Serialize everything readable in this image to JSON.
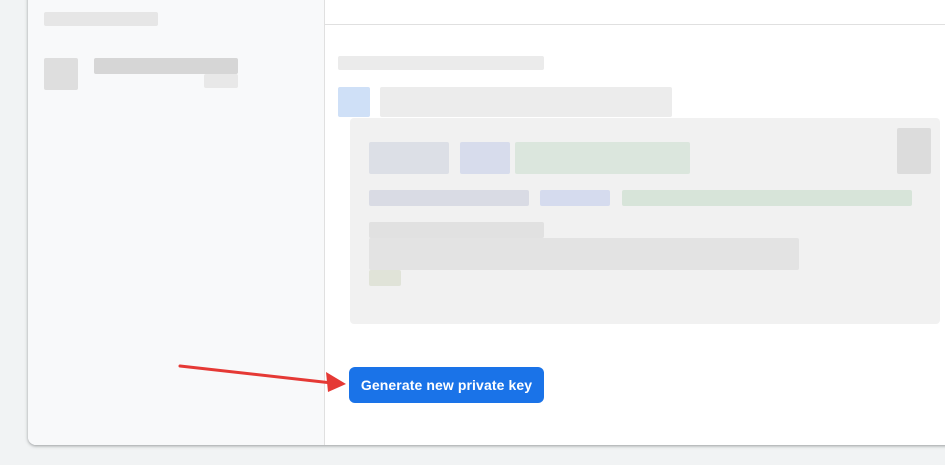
{
  "button": {
    "label": "Generate new private key"
  },
  "colors": {
    "button_bg": "#1a73e8",
    "annotation_arrow": "#e53935",
    "page_bg": "#f1f3f4",
    "sidebar_bg": "#f8f9fa"
  }
}
